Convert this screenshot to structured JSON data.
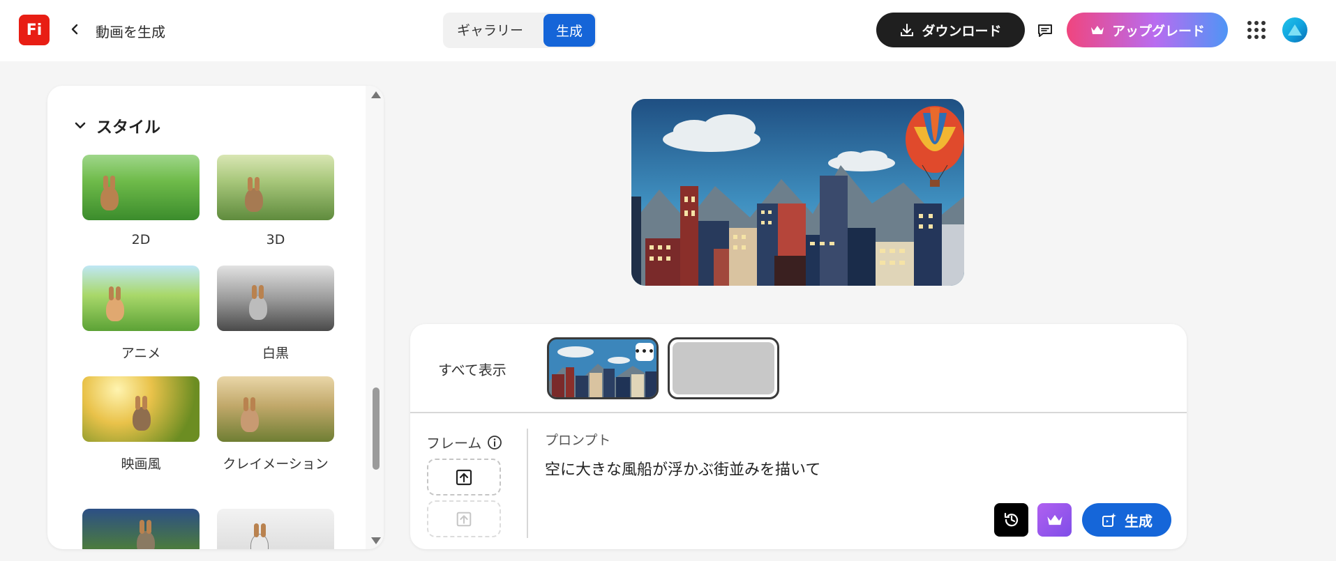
{
  "header": {
    "logo_text": "Fi",
    "title": "動画を生成",
    "tabs": [
      {
        "label": "ギャラリー",
        "active": false
      },
      {
        "label": "生成",
        "active": true
      }
    ],
    "download_label": "ダウンロード",
    "upgrade_label": "アップグレード"
  },
  "style_panel": {
    "section_title": "スタイル",
    "styles": [
      {
        "label": "2D"
      },
      {
        "label": "3D"
      },
      {
        "label": "アニメ"
      },
      {
        "label": "白黒"
      },
      {
        "label": "映画風"
      },
      {
        "label": "クレイメーション"
      }
    ]
  },
  "editor": {
    "show_all_label": "すべて表示",
    "frame_label": "フレーム",
    "prompt_label": "プロンプト",
    "prompt_text": "空に大きな風船が浮かぶ街並みを描いて",
    "generate_label": "生成"
  },
  "colors": {
    "brand_red": "#e81e14",
    "primary_blue": "#1565d8",
    "download_dark": "#1f1f1f",
    "premium_purple": "#9a58ee"
  },
  "icons": {
    "back": "chevron-left-icon",
    "download": "download-icon",
    "chat": "chat-icon",
    "crown": "crown-icon",
    "apps": "apps-grid-icon",
    "collapse": "chevron-down-icon",
    "info": "info-icon",
    "upload": "upload-icon",
    "history": "history-icon",
    "generate": "generate-icon",
    "more": "more-icon"
  }
}
